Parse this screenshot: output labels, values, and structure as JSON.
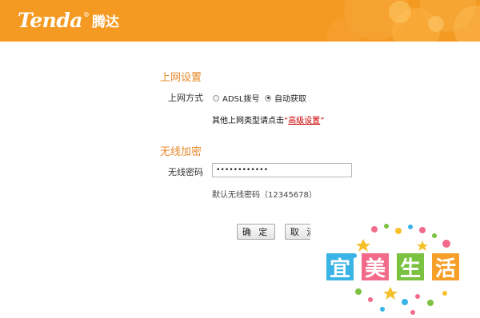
{
  "brand": {
    "name_en": "Tenda",
    "trademark": "®",
    "name_cn": "腾达"
  },
  "internet_section": {
    "title": "上网设置",
    "mode_label": "上网方式",
    "options": [
      {
        "label": "ADSL拨号",
        "checked": false
      },
      {
        "label": "自动获取",
        "checked": true
      }
    ],
    "hint_prefix": "其他上网类型请点击",
    "hint_quote_open": "“",
    "hint_link": "高级设置",
    "hint_quote_close": "”"
  },
  "wireless_section": {
    "title": "无线加密",
    "password_label": "无线密码",
    "password_value": "••••••••••••",
    "default_hint": "默认无线密码（12345678）"
  },
  "buttons": {
    "ok": "确 定",
    "cancel": "取 消"
  },
  "watermark": {
    "chars": [
      "宜",
      "美",
      "生",
      "活"
    ]
  },
  "colors": {
    "header": "#f49a22",
    "section_title": "#e8892c",
    "link": "#cc0000"
  }
}
